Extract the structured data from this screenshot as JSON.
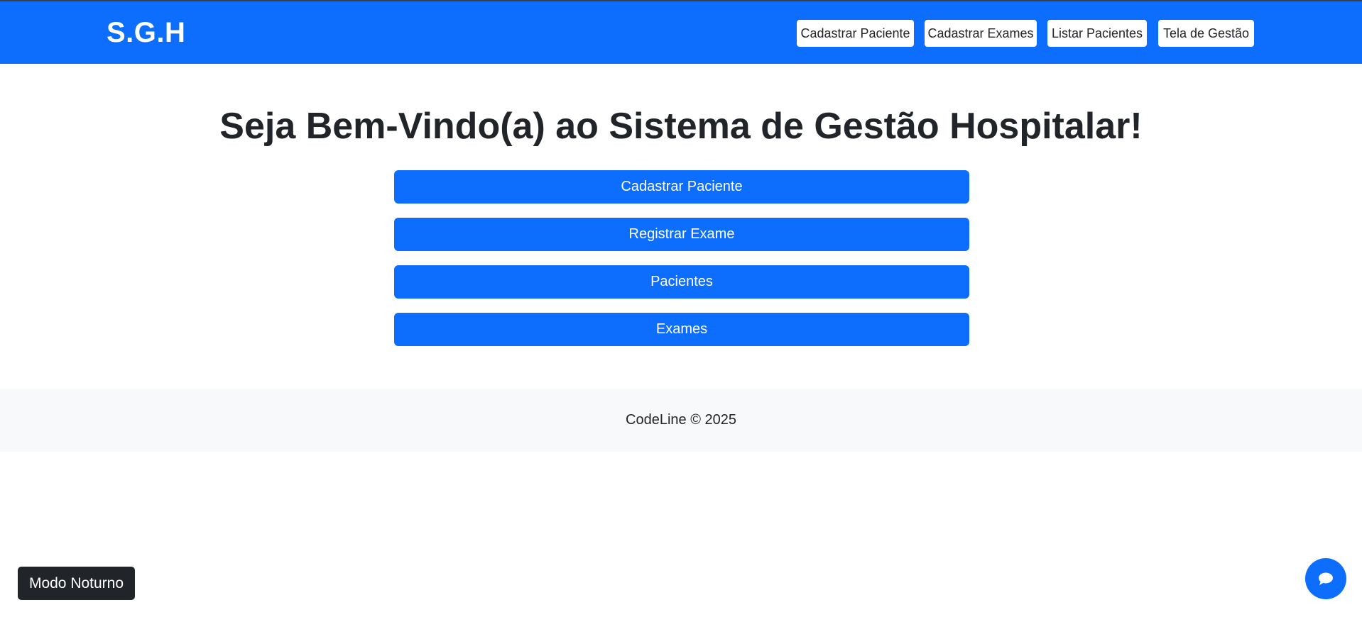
{
  "brand": {
    "label": "S.G.H"
  },
  "nav": {
    "items": [
      {
        "label": "Cadastrar Paciente"
      },
      {
        "label": "Cadastrar Exames"
      },
      {
        "label": "Listar Pacientes"
      },
      {
        "label": "Tela de Gestão"
      }
    ]
  },
  "main": {
    "heading": "Seja Bem-Vindo(a) ao Sistema de Gestão Hospitalar!",
    "buttons": [
      {
        "label": "Cadastrar Paciente"
      },
      {
        "label": "Registrar Exame"
      },
      {
        "label": "Pacientes"
      },
      {
        "label": "Exames"
      }
    ]
  },
  "footer": {
    "text": "CodeLine © 2025"
  },
  "night_mode": {
    "label": "Modo Noturno"
  },
  "chat": {
    "icon": "chat-bubble-icon"
  },
  "colors": {
    "primary": "#0d6efd",
    "dark": "#212529",
    "footer_bg": "#f8f9fa",
    "white": "#ffffff"
  }
}
